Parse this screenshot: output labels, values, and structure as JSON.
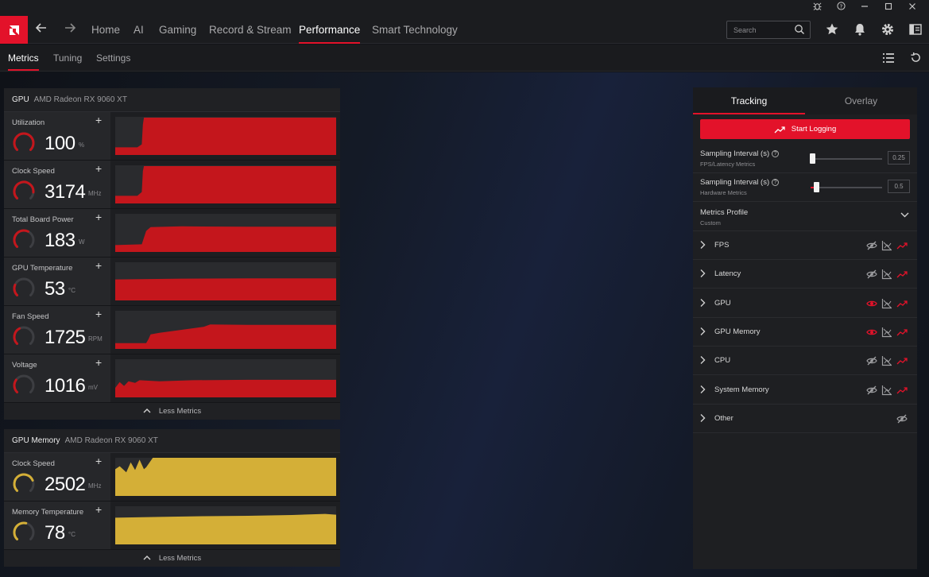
{
  "titlebar": {
    "controls": [
      "bug-icon",
      "help-icon",
      "minimize-icon",
      "maximize-icon",
      "close-icon"
    ]
  },
  "nav": {
    "tabs": [
      {
        "label": "Home",
        "active": false
      },
      {
        "label": "AI",
        "active": false
      },
      {
        "label": "Gaming",
        "active": false
      },
      {
        "label": "Record & Stream",
        "active": false
      },
      {
        "label": "Performance",
        "active": true
      },
      {
        "label": "Smart Technology",
        "active": false
      }
    ],
    "search_placeholder": "Search"
  },
  "subnav": {
    "tabs": [
      {
        "label": "Metrics",
        "active": true
      },
      {
        "label": "Tuning",
        "active": false
      },
      {
        "label": "Settings",
        "active": false
      }
    ]
  },
  "colors": {
    "accent": "#e3122a",
    "gpu_chart": "#c4161c",
    "memory_chart": "#d4af37"
  },
  "gpu_panel": {
    "title": "GPU",
    "device": "AMD Radeon RX 9060 XT",
    "less_metrics": "Less Metrics",
    "metrics": [
      {
        "label": "Utilization",
        "value": "100",
        "unit": "%",
        "gauge_level": 1.0
      },
      {
        "label": "Clock Speed",
        "value": "3174",
        "unit": "MHz",
        "gauge_level": 0.85
      },
      {
        "label": "Total Board Power",
        "value": "183",
        "unit": "W",
        "gauge_level": 0.6
      },
      {
        "label": "GPU Temperature",
        "value": "53",
        "unit": "°C",
        "gauge_level": 0.25
      },
      {
        "label": "Fan Speed",
        "value": "1725",
        "unit": "RPM",
        "gauge_level": 0.4
      },
      {
        "label": "Voltage",
        "value": "1016",
        "unit": "mV",
        "gauge_level": 0.3
      }
    ]
  },
  "memory_panel": {
    "title": "GPU Memory",
    "device": "AMD Radeon RX 9060 XT",
    "less_metrics": "Less Metrics",
    "metrics": [
      {
        "label": "Clock Speed",
        "value": "2502",
        "unit": "MHz",
        "gauge_level": 0.75
      },
      {
        "label": "Memory Temperature",
        "value": "78",
        "unit": "°C",
        "gauge_level": 0.55
      }
    ]
  },
  "right_panel": {
    "tabs": [
      {
        "label": "Tracking",
        "active": true
      },
      {
        "label": "Overlay",
        "active": false
      }
    ],
    "start_logging": "Start Logging",
    "sampling": [
      {
        "title": "Sampling Interval (s)",
        "subtitle": "FPS/Latency Metrics",
        "value": "0.25",
        "level": 0.0
      },
      {
        "title": "Sampling Interval (s)",
        "subtitle": "Hardware Metrics",
        "value": "0.5",
        "level": 0.05
      }
    ],
    "profile": {
      "title": "Metrics Profile",
      "value": "Custom"
    },
    "rows": [
      {
        "label": "FPS",
        "overlay_visible": false,
        "has_chart": true,
        "has_log": true
      },
      {
        "label": "Latency",
        "overlay_visible": false,
        "has_chart": true,
        "has_log": true
      },
      {
        "label": "GPU",
        "overlay_visible": true,
        "has_chart": true,
        "has_log": true
      },
      {
        "label": "GPU Memory",
        "overlay_visible": true,
        "has_chart": true,
        "has_log": true
      },
      {
        "label": "CPU",
        "overlay_visible": false,
        "has_chart": true,
        "has_log": true
      },
      {
        "label": "System Memory",
        "overlay_visible": false,
        "has_chart": true,
        "has_log": true
      },
      {
        "label": "Other",
        "overlay_visible": false,
        "has_chart": false,
        "has_log": false
      }
    ]
  }
}
